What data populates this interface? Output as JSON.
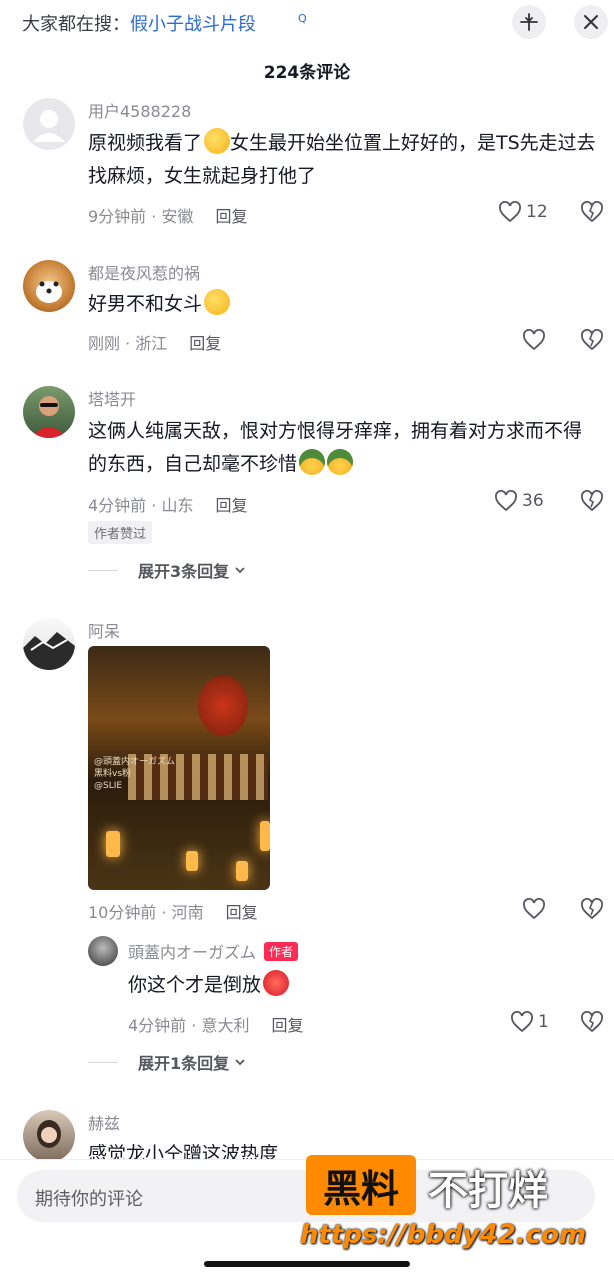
{
  "search": {
    "prefix": "大家都在搜：",
    "term": "假小子战斗片段",
    "search_mark": "Q"
  },
  "header": {
    "title": "224条评论"
  },
  "comments": [
    {
      "user": "用户4588228",
      "text": "原视频我看了",
      "text2": "女生最开始坐位置上好好的，是TS先走过去找麻烦，女生就起身打他了",
      "meta": "9分钟前 · 安徽",
      "reply": "回复",
      "likes": "12"
    },
    {
      "user": "都是夜风惹的祸",
      "text": "好男不和女斗",
      "meta": "刚刚 · 浙江",
      "reply": "回复",
      "likes": ""
    },
    {
      "user": "塔塔开",
      "text": "这俩人纯属天敌，恨对方恨得牙痒痒，拥有着对方求而不得的东西，自己却毫不珍惜",
      "meta": "4分钟前 · 山东",
      "reply": "回复",
      "likes": "36",
      "tag": "作者赞过",
      "expand": "展开3条回复"
    },
    {
      "user": "阿呆",
      "meta": "10分钟前 · 河南",
      "reply": "回复",
      "likes": ""
    },
    {
      "user": "赫兹",
      "text": "感觉龙小仝蹭这波热度"
    }
  ],
  "nested_reply": {
    "user": "頭蓋内オーガズム",
    "badge": "作者",
    "text": "你这个才是倒放",
    "meta": "4分钟前 · 意大利",
    "reply": "回复",
    "likes": "1",
    "expand": "展开1条回复"
  },
  "video_overlay": {
    "line1": "@頭蓋内オーガズム",
    "line2": "黑料vs粉",
    "line3": "@SLIE"
  },
  "watermark": {
    "brand1": "黑料",
    "brand2": "不打烊",
    "url": "https://bbdy42.com"
  },
  "input": {
    "placeholder": "期待你的评论"
  },
  "colors": {
    "link": "#2c6bd3",
    "author_badge": "#fe2c55",
    "watermark": "#ff8a00"
  }
}
